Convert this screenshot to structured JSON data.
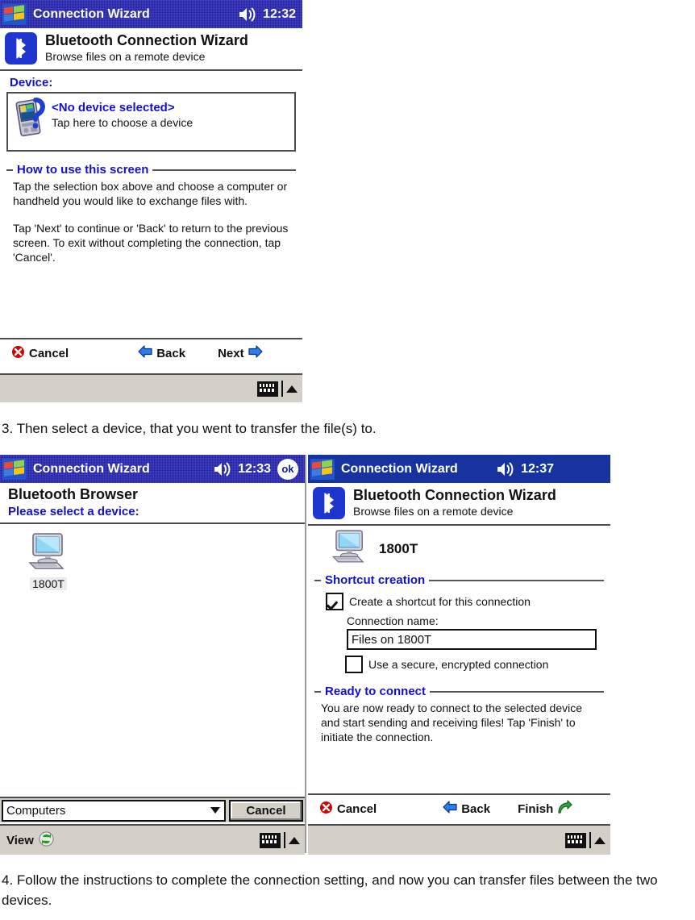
{
  "captions": {
    "step3": "3. Then select a device, that you went to transfer the file(s) to.",
    "step4": "4. Follow the instructions to complete the connection setting, and now you can transfer files between the two devices."
  },
  "screen1": {
    "titlebar": {
      "title": "Connection Wizard",
      "clock": "12:32",
      "speaker_icon": "speaker-icon",
      "start_icon": "windows-flag-icon"
    },
    "header": {
      "icon": "bluetooth-icon",
      "title": "Bluetooth Connection Wizard",
      "subtitle": "Browse files on a remote device"
    },
    "device_field": {
      "label": "Device:",
      "icon": "handheld-device-icon",
      "name": "<No device selected>",
      "hint": "Tap here to choose a device"
    },
    "help_group": {
      "legend": "How to use this screen",
      "paragraph1": "Tap the selection box above and choose a computer or handheld you would like to exchange files with.",
      "paragraph2": "Tap 'Next' to continue or 'Back' to return to the previous screen. To exit without completing the connection, tap 'Cancel'."
    },
    "commandbar": {
      "cancel": "Cancel",
      "back": "Back",
      "next": "Next",
      "cancel_icon": "cancel-x-icon",
      "back_icon": "arrow-left-icon",
      "next_icon": "arrow-right-icon"
    },
    "taskbar": {
      "keyboard_icon": "keyboard-icon",
      "expand_icon": "chevron-up-icon"
    }
  },
  "screen2": {
    "titlebar": {
      "title": "Connection Wizard",
      "clock": "12:33",
      "ok_label": "ok",
      "speaker_icon": "speaker-icon",
      "start_icon": "windows-flag-icon"
    },
    "header": {
      "title": "Bluetooth Browser",
      "subtitle": "Please select a device:"
    },
    "devices": [
      {
        "icon": "desktop-computer-icon",
        "label": "1800T"
      }
    ],
    "filter": {
      "value": "Computers",
      "caret_icon": "chevron-down-icon"
    },
    "cancel_button": "Cancel",
    "taskbar": {
      "view_label": "View",
      "refresh_icon": "refresh-icon",
      "keyboard_icon": "keyboard-icon",
      "expand_icon": "chevron-up-icon"
    }
  },
  "screen3": {
    "titlebar": {
      "title": "Connection Wizard",
      "clock": "12:37",
      "speaker_icon": "speaker-icon",
      "start_icon": "windows-flag-icon"
    },
    "header": {
      "icon": "bluetooth-icon",
      "title": "Bluetooth Connection Wizard",
      "subtitle": "Browse files on a remote device"
    },
    "selected_device": {
      "icon": "desktop-computer-icon",
      "name": "1800T"
    },
    "shortcut_group": {
      "legend": "Shortcut creation",
      "create_shortcut_label": "Create a shortcut for this connection",
      "create_shortcut_checked": true,
      "connection_name_label": "Connection name:",
      "connection_name_value": "Files on 1800T",
      "secure_label": "Use a secure, encrypted connection",
      "secure_checked": false
    },
    "ready_group": {
      "legend": "Ready to connect",
      "paragraph": "You are now ready to connect to the selected device and start sending and receiving files! Tap 'Finish' to initiate the connection."
    },
    "commandbar": {
      "cancel": "Cancel",
      "back": "Back",
      "finish": "Finish",
      "cancel_icon": "cancel-x-icon",
      "back_icon": "arrow-left-icon",
      "finish_icon": "arrow-curved-right-icon"
    },
    "taskbar": {
      "keyboard_icon": "keyboard-icon",
      "expand_icon": "chevron-up-icon"
    }
  },
  "colors": {
    "titlebar_blue": "#1c1ca8",
    "accent_blue": "#1111cc",
    "bluetooth_blue": "#1f35cf",
    "taskbar_gray": "#d4d0c8"
  }
}
